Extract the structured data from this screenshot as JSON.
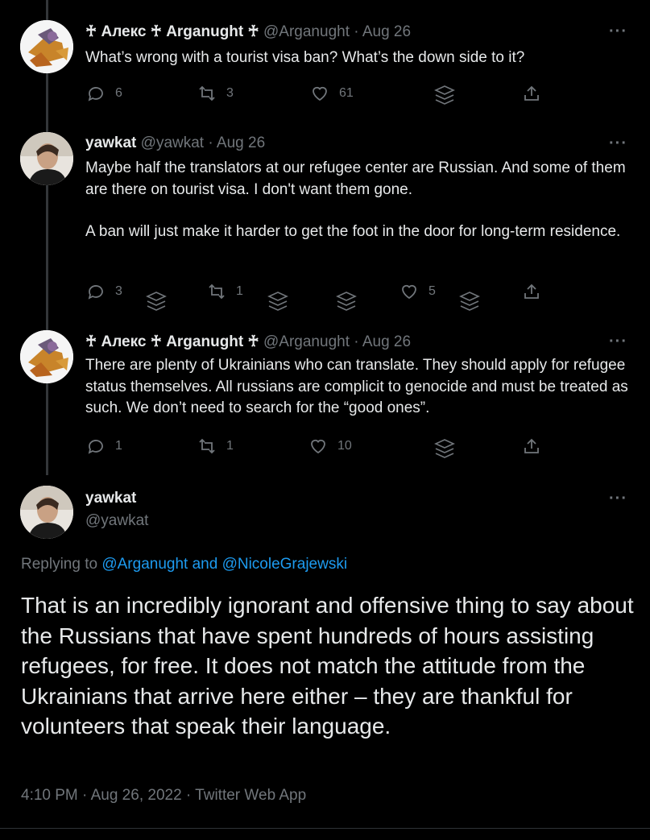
{
  "tweets": [
    {
      "name": "♰ Алекс ♰ Arganught ♰",
      "handle": "@Arganught",
      "date": "· Aug 26",
      "text": [
        "What’s wrong with a tourist visa ban? What’s the down side to it?"
      ],
      "replies": "6",
      "retweets": "3",
      "likes": "61"
    },
    {
      "name": "yawkat",
      "handle": "@yawkat",
      "date": "· Aug 26",
      "text": [
        "Maybe half the translators at our refugee center are Russian. And some of them are there on tourist visa. I don't want them gone.",
        "A ban will just make it harder to get the foot in the door for long-term residence."
      ],
      "replies": "3",
      "retweets": "1",
      "likes": "5"
    },
    {
      "name": "♰ Алекс ♰ Arganught ♰",
      "handle": "@Arganught",
      "date": "· Aug 26",
      "text": [
        "There are plenty of Ukrainians who can translate. They should apply for refugee status themselves. All russians are complicit to genocide and must be treated as such. We don’t need to search for the “good ones”."
      ],
      "replies": "1",
      "retweets": "1",
      "likes": "10"
    }
  ],
  "main_tweet": {
    "name": "yawkat",
    "handle": "@yawkat",
    "replying_prefix": "Replying to",
    "replying_to": "@Arganught and @NicoleGrajewski",
    "text": "That is an incredibly ignorant and offensive thing to say about the Russians that have spent hundreds of hours assisting refugees, for free. It does not match the attitude from the Ukrainians that arrive here either – they are thankful for volunteers that speak their language.",
    "timestamp": "4:10 PM · Aug 26, 2022 · Twitter Web App"
  },
  "more_label": "···",
  "icons": [
    "reply-icon",
    "retweet-icon",
    "like-icon",
    "layers-icon",
    "share-icon",
    "more-icon"
  ],
  "colors": {
    "background": "#000000",
    "text": "#e7e9ea",
    "secondary": "#71767b",
    "link": "#1d9bf0"
  }
}
